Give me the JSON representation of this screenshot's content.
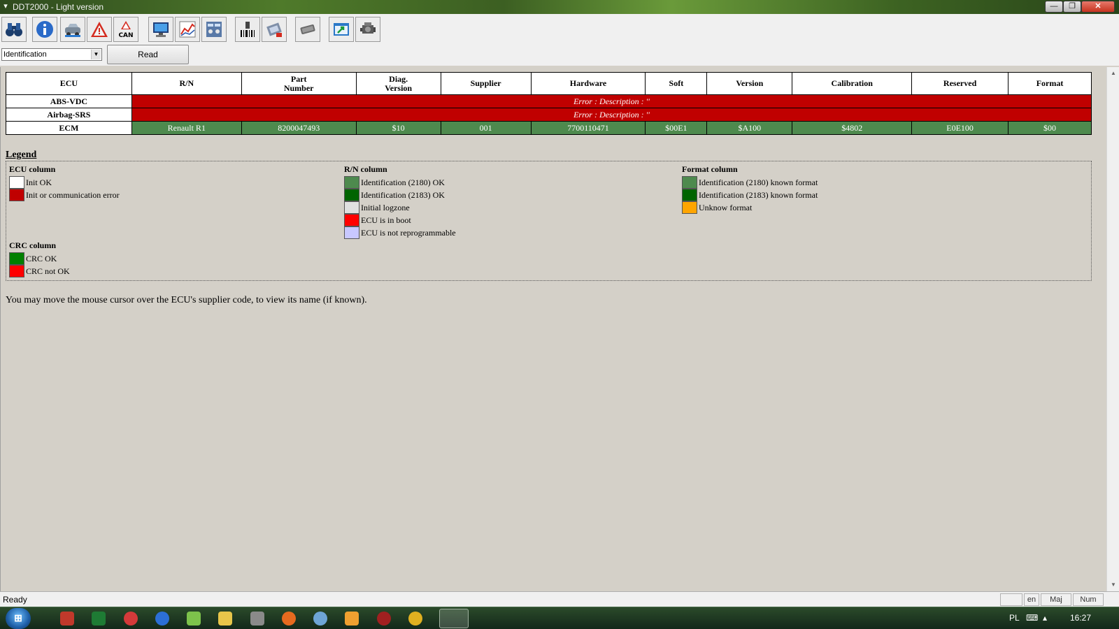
{
  "window": {
    "title": "DDT2000 - Light version",
    "min_glyph": "—",
    "max_glyph": "❐",
    "close_glyph": "✕",
    "sys_glyph": "▾"
  },
  "toolbar": {
    "buttons": [
      {
        "name": "binoculars-icon"
      },
      {
        "name": "info-icon"
      },
      {
        "name": "vehicle-icon"
      },
      {
        "name": "warning-icon"
      },
      {
        "name": "can-icon",
        "label": "CAN"
      },
      {
        "name": "monitor-icon"
      },
      {
        "name": "chart-icon"
      },
      {
        "name": "panel-icon"
      },
      {
        "name": "barcode-reader-icon"
      },
      {
        "name": "reprogram-icon"
      },
      {
        "name": "chip-icon"
      },
      {
        "name": "export-icon"
      },
      {
        "name": "engine-icon"
      }
    ]
  },
  "selector": {
    "value": "Identification",
    "read_label": "Read"
  },
  "table": {
    "headers": [
      "ECU",
      "R/N",
      "Part Number",
      "Diag. Version",
      "Supplier",
      "Hardware",
      "Soft",
      "Version",
      "Calibration",
      "Reserved",
      "Format"
    ],
    "rows": [
      {
        "ecu": "ABS-VDC",
        "error": "Error : Description : ''"
      },
      {
        "ecu": "Airbag-SRS",
        "error": "Error : Description : ''"
      },
      {
        "ecu": "ECM",
        "cells": [
          "Renault R1",
          "8200047493",
          "$10",
          "001",
          "7700110471",
          "$00E1",
          "$A100",
          "$4802",
          "E0E100",
          "$00"
        ]
      }
    ]
  },
  "legend": {
    "title": "Legend",
    "ecu_column": {
      "title": "ECU column",
      "items": [
        {
          "color": "#ffffff",
          "label": "Init OK"
        },
        {
          "color": "#c00000",
          "label": "Init or communication error"
        }
      ]
    },
    "crc_column": {
      "title": "CRC column",
      "items": [
        {
          "color": "#008000",
          "label": "CRC OK"
        },
        {
          "color": "#ff0000",
          "label": "CRC not OK"
        }
      ]
    },
    "rn_column": {
      "title": "R/N column",
      "items": [
        {
          "color": "#4e8a4e",
          "label": "Identification (2180) OK"
        },
        {
          "color": "#006400",
          "label": "Identification (2183) OK"
        },
        {
          "color": "#e0e0e0",
          "label": "Initial logzone"
        },
        {
          "color": "#ff0000",
          "label": "ECU is in boot"
        },
        {
          "color": "#c8c8ff",
          "label": "ECU is not reprogrammable"
        }
      ]
    },
    "format_column": {
      "title": "Format column",
      "items": [
        {
          "color": "#4e8a4e",
          "label": "Identification (2180) known format"
        },
        {
          "color": "#006400",
          "label": "Identification (2183) known format"
        },
        {
          "color": "#ffa500",
          "label": "Unknow format"
        }
      ]
    }
  },
  "note": "You may move the mouse cursor over the ECU's supplier code, to view its name (if known).",
  "statusbar": {
    "text": "Ready",
    "lang": "en",
    "caps": "Maj",
    "num": "Num"
  },
  "taskbar": {
    "start_glyph": "⊞",
    "apps": [
      {
        "name": "app-red-icon",
        "color": "#c0392b"
      },
      {
        "name": "excel-icon",
        "color": "#1e7b34"
      },
      {
        "name": "media-icon",
        "color": "#d43a3a"
      },
      {
        "name": "lightning-icon",
        "color": "#2c6fd6"
      },
      {
        "name": "flag-icon",
        "color": "#7dc24b"
      },
      {
        "name": "folder-icon",
        "color": "#e8c64a"
      },
      {
        "name": "camera-icon",
        "color": "#8a8a8a"
      },
      {
        "name": "firefox-icon",
        "color": "#e66a1f"
      },
      {
        "name": "moon-icon",
        "color": "#6ea5d6"
      },
      {
        "name": "player-icon",
        "color": "#f0a030"
      },
      {
        "name": "pin-icon",
        "color": "#a02020"
      },
      {
        "name": "search-app-icon",
        "color": "#e0b020"
      },
      {
        "name": "ddt2000-task-icon",
        "color": "#cfcfcf"
      }
    ],
    "tray_lang": "PL",
    "clock": "16:27"
  }
}
